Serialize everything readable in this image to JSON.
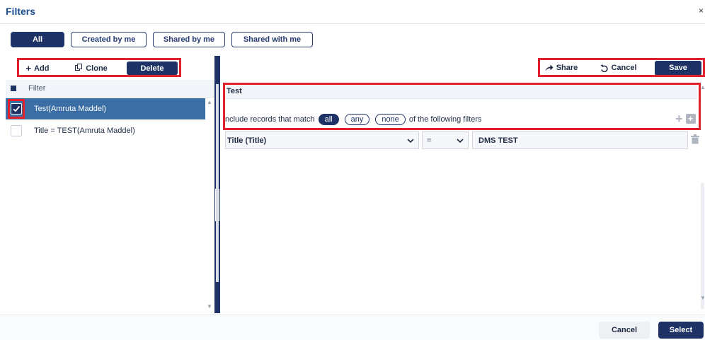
{
  "window": {
    "title": "Filters",
    "close_glyph": "×"
  },
  "tabs": [
    {
      "label": "All",
      "active": true
    },
    {
      "label": "Created by me",
      "active": false
    },
    {
      "label": "Shared by me",
      "active": false
    },
    {
      "label": "Shared with me",
      "active": false
    }
  ],
  "left_toolbar": {
    "add_label": "Add",
    "clone_label": "Clone",
    "delete_label": "Delete"
  },
  "list": {
    "header_label": "Filter",
    "items": [
      {
        "label": "Test(Amruta Maddel)",
        "selected": true,
        "checked": true
      },
      {
        "label": "Title = TEST(Amruta Maddel)",
        "selected": false,
        "checked": false
      }
    ]
  },
  "right_toolbar": {
    "share_label": "Share",
    "cancel_label": "Cancel",
    "save_label": "Save"
  },
  "filter_editor": {
    "name": "Test",
    "match_prefix": "nclude records that match",
    "match_options": [
      {
        "label": "all",
        "active": true
      },
      {
        "label": "any",
        "active": false
      },
      {
        "label": "none",
        "active": false
      }
    ],
    "match_suffix": "of the following filters",
    "condition": {
      "field": "Title (Title)",
      "operator": "=",
      "value": "DMS TEST"
    }
  },
  "footer": {
    "cancel_label": "Cancel",
    "select_label": "Select"
  },
  "colors": {
    "brand_dark": "#1f3266",
    "selection_blue": "#3a6ea5",
    "title_blue": "#1d4f91",
    "highlight_red": "#e0202a"
  }
}
